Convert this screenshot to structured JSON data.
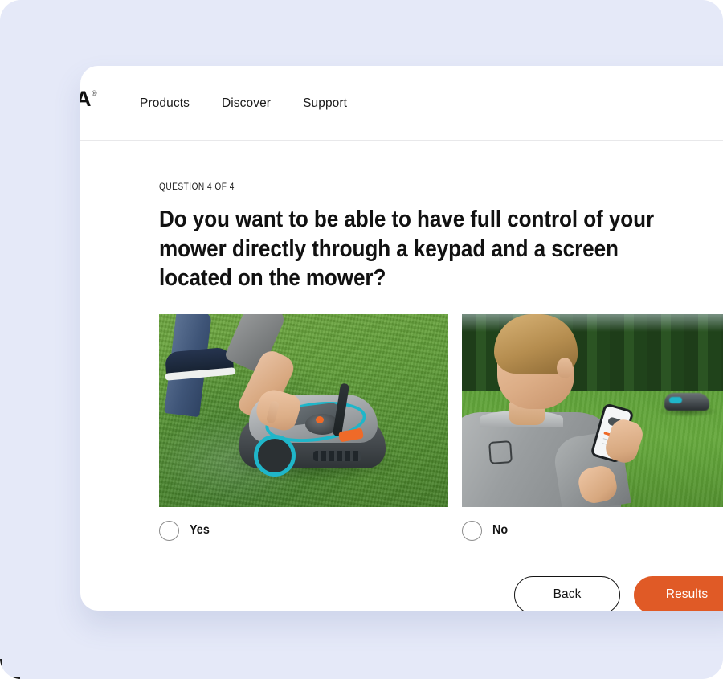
{
  "theme": {
    "page_background": "#ffffff",
    "stage_background": "#e5e9f8",
    "card_background": "#ffffff",
    "accent_orange": "#e05a26",
    "text_primary": "#141414",
    "divider": "#e8e8ea",
    "radio_border": "#8c8c8c"
  },
  "nav": {
    "logo_text": "A",
    "logo_mark": "®",
    "links": [
      {
        "label": "Products"
      },
      {
        "label": "Discover"
      },
      {
        "label": "Support"
      }
    ]
  },
  "quiz": {
    "eyebrow": "QUESTION 4 OF 4",
    "question": "Do you want to be able to have full control of your mower directly through a keypad and a screen located on the mower?",
    "options": [
      {
        "label": "Yes",
        "selected": false,
        "image_alt": "Person pressing the keypad on the top panel of a grey and turquoise robotic lawn mower standing on a green lawn"
      },
      {
        "label": "No",
        "selected": false,
        "image_alt": "Blond man in a grey sweater controlling a robotic lawn mower from a smartphone app while the mower works on the lawn behind him"
      }
    ]
  },
  "actions": {
    "back_label": "Back",
    "results_label": "Results"
  }
}
